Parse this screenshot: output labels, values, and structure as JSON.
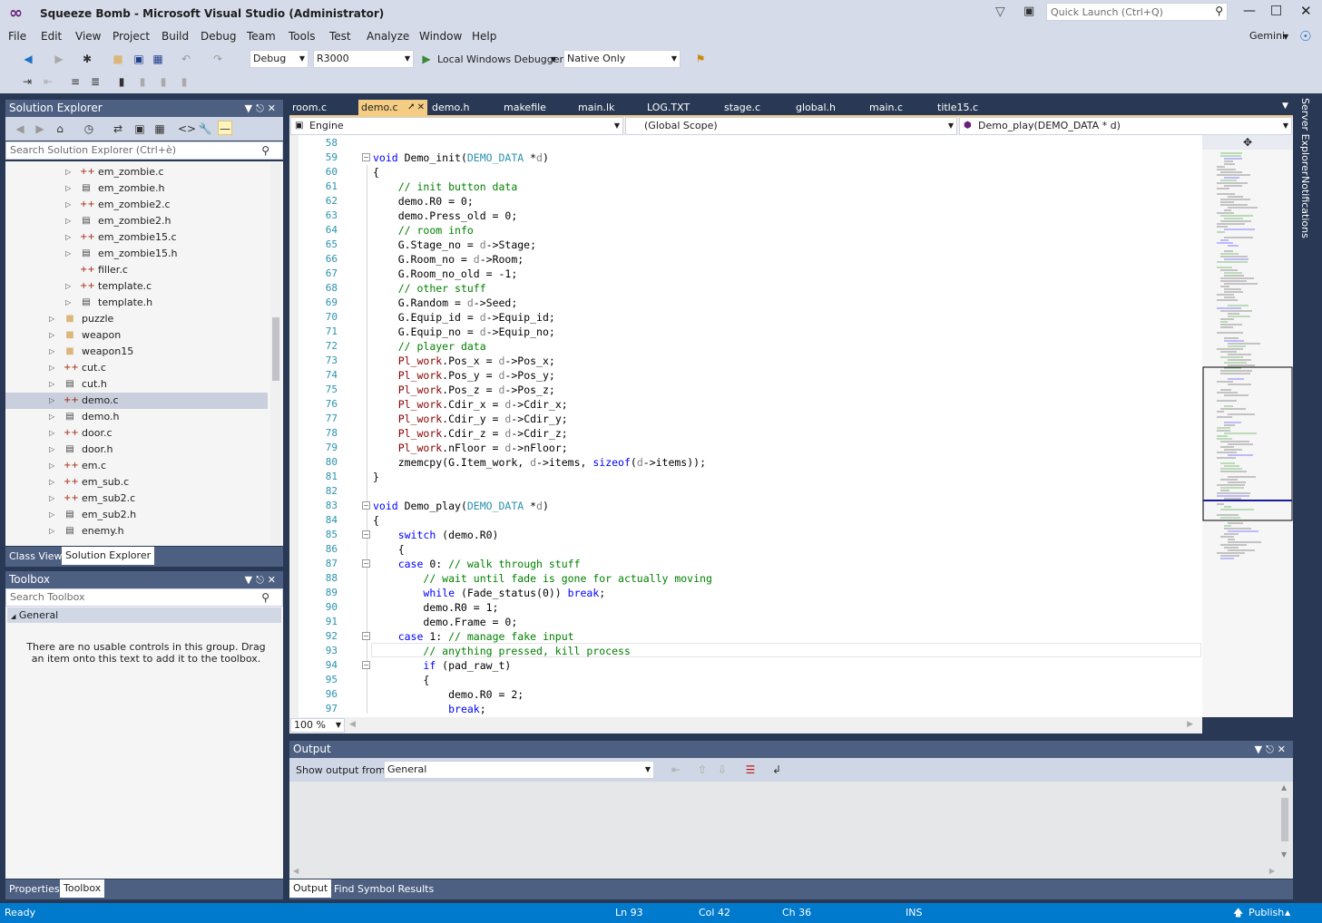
{
  "title": "Squeeze Bomb - Microsoft Visual Studio (Administrator)",
  "quick_launch_placeholder": "Quick Launch (Ctrl+Q)",
  "user": "Gemini",
  "menu": [
    "File",
    "Edit",
    "View",
    "Project",
    "Build",
    "Debug",
    "Team",
    "Tools",
    "Test",
    "Analyze",
    "Window",
    "Help"
  ],
  "toolbar": {
    "config": "Debug",
    "platform": "R3000",
    "debugger": "Local Windows Debugger",
    "debug_mode": "Native Only"
  },
  "solution_explorer": {
    "title": "Solution Explorer",
    "search_placeholder": "Search Solution Explorer (Ctrl+è)",
    "items": [
      {
        "label": "em_zombie.c",
        "type": "c",
        "depth": 2,
        "expand": true
      },
      {
        "label": "em_zombie.h",
        "type": "h",
        "depth": 2,
        "expand": true
      },
      {
        "label": "em_zombie2.c",
        "type": "c",
        "depth": 2,
        "expand": true
      },
      {
        "label": "em_zombie2.h",
        "type": "h",
        "depth": 2,
        "expand": true
      },
      {
        "label": "em_zombie15.c",
        "type": "c",
        "depth": 2,
        "expand": true
      },
      {
        "label": "em_zombie15.h",
        "type": "h",
        "depth": 2,
        "expand": true
      },
      {
        "label": "filler.c",
        "type": "c",
        "depth": 2,
        "expand": false
      },
      {
        "label": "template.c",
        "type": "c",
        "depth": 2,
        "expand": true
      },
      {
        "label": "template.h",
        "type": "h",
        "depth": 2,
        "expand": true
      },
      {
        "label": "puzzle",
        "type": "folder",
        "depth": 1,
        "expand": true
      },
      {
        "label": "weapon",
        "type": "folder",
        "depth": 1,
        "expand": true
      },
      {
        "label": "weapon15",
        "type": "folder",
        "depth": 1,
        "expand": true
      },
      {
        "label": "cut.c",
        "type": "c",
        "depth": 1,
        "expand": true
      },
      {
        "label": "cut.h",
        "type": "h",
        "depth": 1,
        "expand": true
      },
      {
        "label": "demo.c",
        "type": "c",
        "depth": 1,
        "expand": true,
        "selected": true
      },
      {
        "label": "demo.h",
        "type": "h",
        "depth": 1,
        "expand": true
      },
      {
        "label": "door.c",
        "type": "c",
        "depth": 1,
        "expand": true
      },
      {
        "label": "door.h",
        "type": "h",
        "depth": 1,
        "expand": true
      },
      {
        "label": "em.c",
        "type": "c",
        "depth": 1,
        "expand": true
      },
      {
        "label": "em_sub.c",
        "type": "c",
        "depth": 1,
        "expand": true
      },
      {
        "label": "em_sub2.c",
        "type": "c",
        "depth": 1,
        "expand": true
      },
      {
        "label": "em_sub2.h",
        "type": "h",
        "depth": 1,
        "expand": true
      },
      {
        "label": "enemy.h",
        "type": "h",
        "depth": 1,
        "expand": true
      }
    ],
    "bottom_tabs": [
      "Class View",
      "Solution Explorer"
    ]
  },
  "toolbox": {
    "title": "Toolbox",
    "search_placeholder": "Search Toolbox",
    "group": "General",
    "empty_text": "There are no usable controls in this group. Drag an item onto this text to add it to the toolbox.",
    "bottom_tabs": [
      "Properties",
      "Toolbox"
    ]
  },
  "doc_tabs": [
    "room.c",
    "demo.c",
    "demo.h",
    "makefile",
    "main.lk",
    "LOG.TXT",
    "stage.c",
    "global.h",
    "main.c",
    "title15.c"
  ],
  "nav": {
    "project": "Engine",
    "scope": "(Global Scope)",
    "member": "Demo_play(DEMO_DATA * d)"
  },
  "editor": {
    "zoom": "100 %",
    "lines": [
      {
        "n": "58",
        "t": ""
      },
      {
        "n": "59",
        "t": "<span class=\"kw\">void</span> Demo_init(<span class=\"ty\">DEMO_DATA</span> *<span class=\"pr\">d</span>)",
        "fold": true
      },
      {
        "n": "60",
        "t": "{"
      },
      {
        "n": "61",
        "t": "    <span class=\"cm\">// init button data</span>"
      },
      {
        "n": "62",
        "t": "    demo.R0 = 0;"
      },
      {
        "n": "63",
        "t": "    demo.Press_old = 0;"
      },
      {
        "n": "64",
        "t": "    <span class=\"cm\">// room info</span>"
      },
      {
        "n": "65",
        "t": "    G.Stage_no = <span class=\"pr\">d</span>->Stage;"
      },
      {
        "n": "66",
        "t": "    G.Room_no = <span class=\"pr\">d</span>->Room;"
      },
      {
        "n": "67",
        "t": "    G.Room_no_old = -1;"
      },
      {
        "n": "68",
        "t": "    <span class=\"cm\">// other stuff</span>"
      },
      {
        "n": "69",
        "t": "    G.Random = <span class=\"pr\">d</span>->Seed;"
      },
      {
        "n": "70",
        "t": "    G.Equip_id = <span class=\"pr\">d</span>->Equip_id;"
      },
      {
        "n": "71",
        "t": "    G.Equip_no = <span class=\"pr\">d</span>->Equip_no;"
      },
      {
        "n": "72",
        "t": "    <span class=\"cm\">// player data</span>"
      },
      {
        "n": "73",
        "t": "    <span class=\"fn\">Pl_work</span>.Pos_x = <span class=\"pr\">d</span>->Pos_x;"
      },
      {
        "n": "74",
        "t": "    <span class=\"fn\">Pl_work</span>.Pos_y = <span class=\"pr\">d</span>->Pos_y;"
      },
      {
        "n": "75",
        "t": "    <span class=\"fn\">Pl_work</span>.Pos_z = <span class=\"pr\">d</span>->Pos_z;"
      },
      {
        "n": "76",
        "t": "    <span class=\"fn\">Pl_work</span>.Cdir_x = <span class=\"pr\">d</span>->Cdir_x;"
      },
      {
        "n": "77",
        "t": "    <span class=\"fn\">Pl_work</span>.Cdir_y = <span class=\"pr\">d</span>->Cdir_y;"
      },
      {
        "n": "78",
        "t": "    <span class=\"fn\">Pl_work</span>.Cdir_z = <span class=\"pr\">d</span>->Cdir_z;"
      },
      {
        "n": "79",
        "t": "    <span class=\"fn\">Pl_work</span>.nFloor = <span class=\"pr\">d</span>->nFloor;"
      },
      {
        "n": "80",
        "t": "    zmemcpy(G.Item_work, <span class=\"pr\">d</span>->items, <span class=\"kw\">sizeof</span>(<span class=\"pr\">d</span>->items));"
      },
      {
        "n": "81",
        "t": "}"
      },
      {
        "n": "82",
        "t": ""
      },
      {
        "n": "83",
        "t": "<span class=\"kw\">void</span> Demo_play(<span class=\"ty\">DEMO_DATA</span> *<span class=\"pr\">d</span>)",
        "fold": true
      },
      {
        "n": "84",
        "t": "{"
      },
      {
        "n": "85",
        "t": "    <span class=\"kw\">switch</span> (demo.R0)",
        "fold": true
      },
      {
        "n": "86",
        "t": "    {"
      },
      {
        "n": "87",
        "t": "    <span class=\"kw\">case</span> 0: <span class=\"cm\">// walk through stuff</span>",
        "fold": true
      },
      {
        "n": "88",
        "t": "        <span class=\"cm\">// wait until fade is gone for actually moving</span>"
      },
      {
        "n": "89",
        "t": "        <span class=\"kw\">while</span> (Fade_status(0)) <span class=\"kw\">break</span>;"
      },
      {
        "n": "90",
        "t": "        demo.R0 = 1;"
      },
      {
        "n": "91",
        "t": "        demo.Frame = 0;"
      },
      {
        "n": "92",
        "t": "    <span class=\"kw\">case</span> 1: <span class=\"cm\">// manage fake input</span>",
        "fold": true
      },
      {
        "n": "93",
        "t": "        <span class=\"cm\">// anything pressed, kill process</span>"
      },
      {
        "n": "94",
        "t": "        <span class=\"kw\">if</span> (pad_raw_t)",
        "fold": true
      },
      {
        "n": "95",
        "t": "        {"
      },
      {
        "n": "96",
        "t": "            demo.R0 = 2;"
      },
      {
        "n": "97",
        "t": "            <span class=\"kw\">break</span>;"
      }
    ]
  },
  "output": {
    "title": "Output",
    "show_from_label": "Show output from:",
    "source": "General",
    "bottom_tabs": [
      "Output",
      "Find Symbol Results"
    ]
  },
  "side_tabs": [
    "Server Explorer",
    "Notifications"
  ],
  "status": {
    "ready": "Ready",
    "ln": "Ln 93",
    "col": "Col 42",
    "ch": "Ch 36",
    "ins": "INS",
    "publish": "Publish"
  },
  "colors": {
    "accent": "#007acc",
    "frame": "#293955",
    "active_tab": "#f5cc84"
  }
}
